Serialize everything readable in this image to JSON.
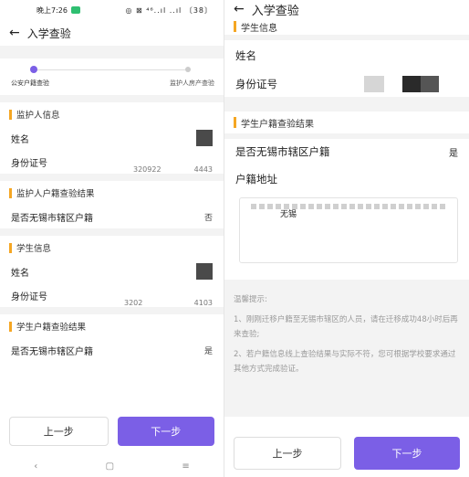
{
  "left": {
    "status_bar": {
      "time": "晚上7:26",
      "indicators": "◎ ⊠ ⁴⁶..ıl ..ıl 〔38〕"
    },
    "nav": {
      "title": "入学查验",
      "back_icon": "←"
    },
    "steps": {
      "step1": "公安户籍查验",
      "step2": "监护人房产查验"
    },
    "guardian_info": {
      "title": "监护人信息",
      "name_label": "姓名",
      "id_label": "身份证号",
      "id_partial_left": "320922",
      "id_partial_right": "4443"
    },
    "guardian_result": {
      "title": "监护人户籍查验结果",
      "question": "是否无锡市辖区户籍",
      "answer": "否"
    },
    "student_info": {
      "title": "学生信息",
      "name_label": "姓名",
      "id_label": "身份证号",
      "id_partial_left": "3202",
      "id_partial_right": "4103"
    },
    "student_result": {
      "title": "学生户籍查验结果",
      "question": "是否无锡市辖区户籍",
      "answer": "是"
    },
    "buttons": {
      "prev": "上一步",
      "next": "下一步"
    },
    "system_nav": {
      "back": "‹",
      "home": "▢",
      "menu": "≡"
    }
  },
  "right": {
    "nav": {
      "title": "入学查验",
      "back_icon": "←"
    },
    "student_info": {
      "title": "学生信息",
      "name_label": "姓名",
      "id_label": "身份证号"
    },
    "student_result": {
      "title": "学生户籍查验结果",
      "question": "是否无锡市辖区户籍",
      "answer": "是",
      "address_label": "户籍地址",
      "address_value": "无锡"
    },
    "tips": {
      "heading": "温馨提示:",
      "line1": "1、刚刚迁移户籍至无锡市辖区的人员，请在迁移成功48小时后再来查验;",
      "line2": "2、若户籍信息线上查验结果与实际不符，您可根据学校要求通过其他方式完成验证。"
    },
    "buttons": {
      "prev": "上一步",
      "next": "下一步"
    }
  },
  "colors": {
    "accent": "#7b5fe6",
    "section_bar": "#f5a623"
  }
}
